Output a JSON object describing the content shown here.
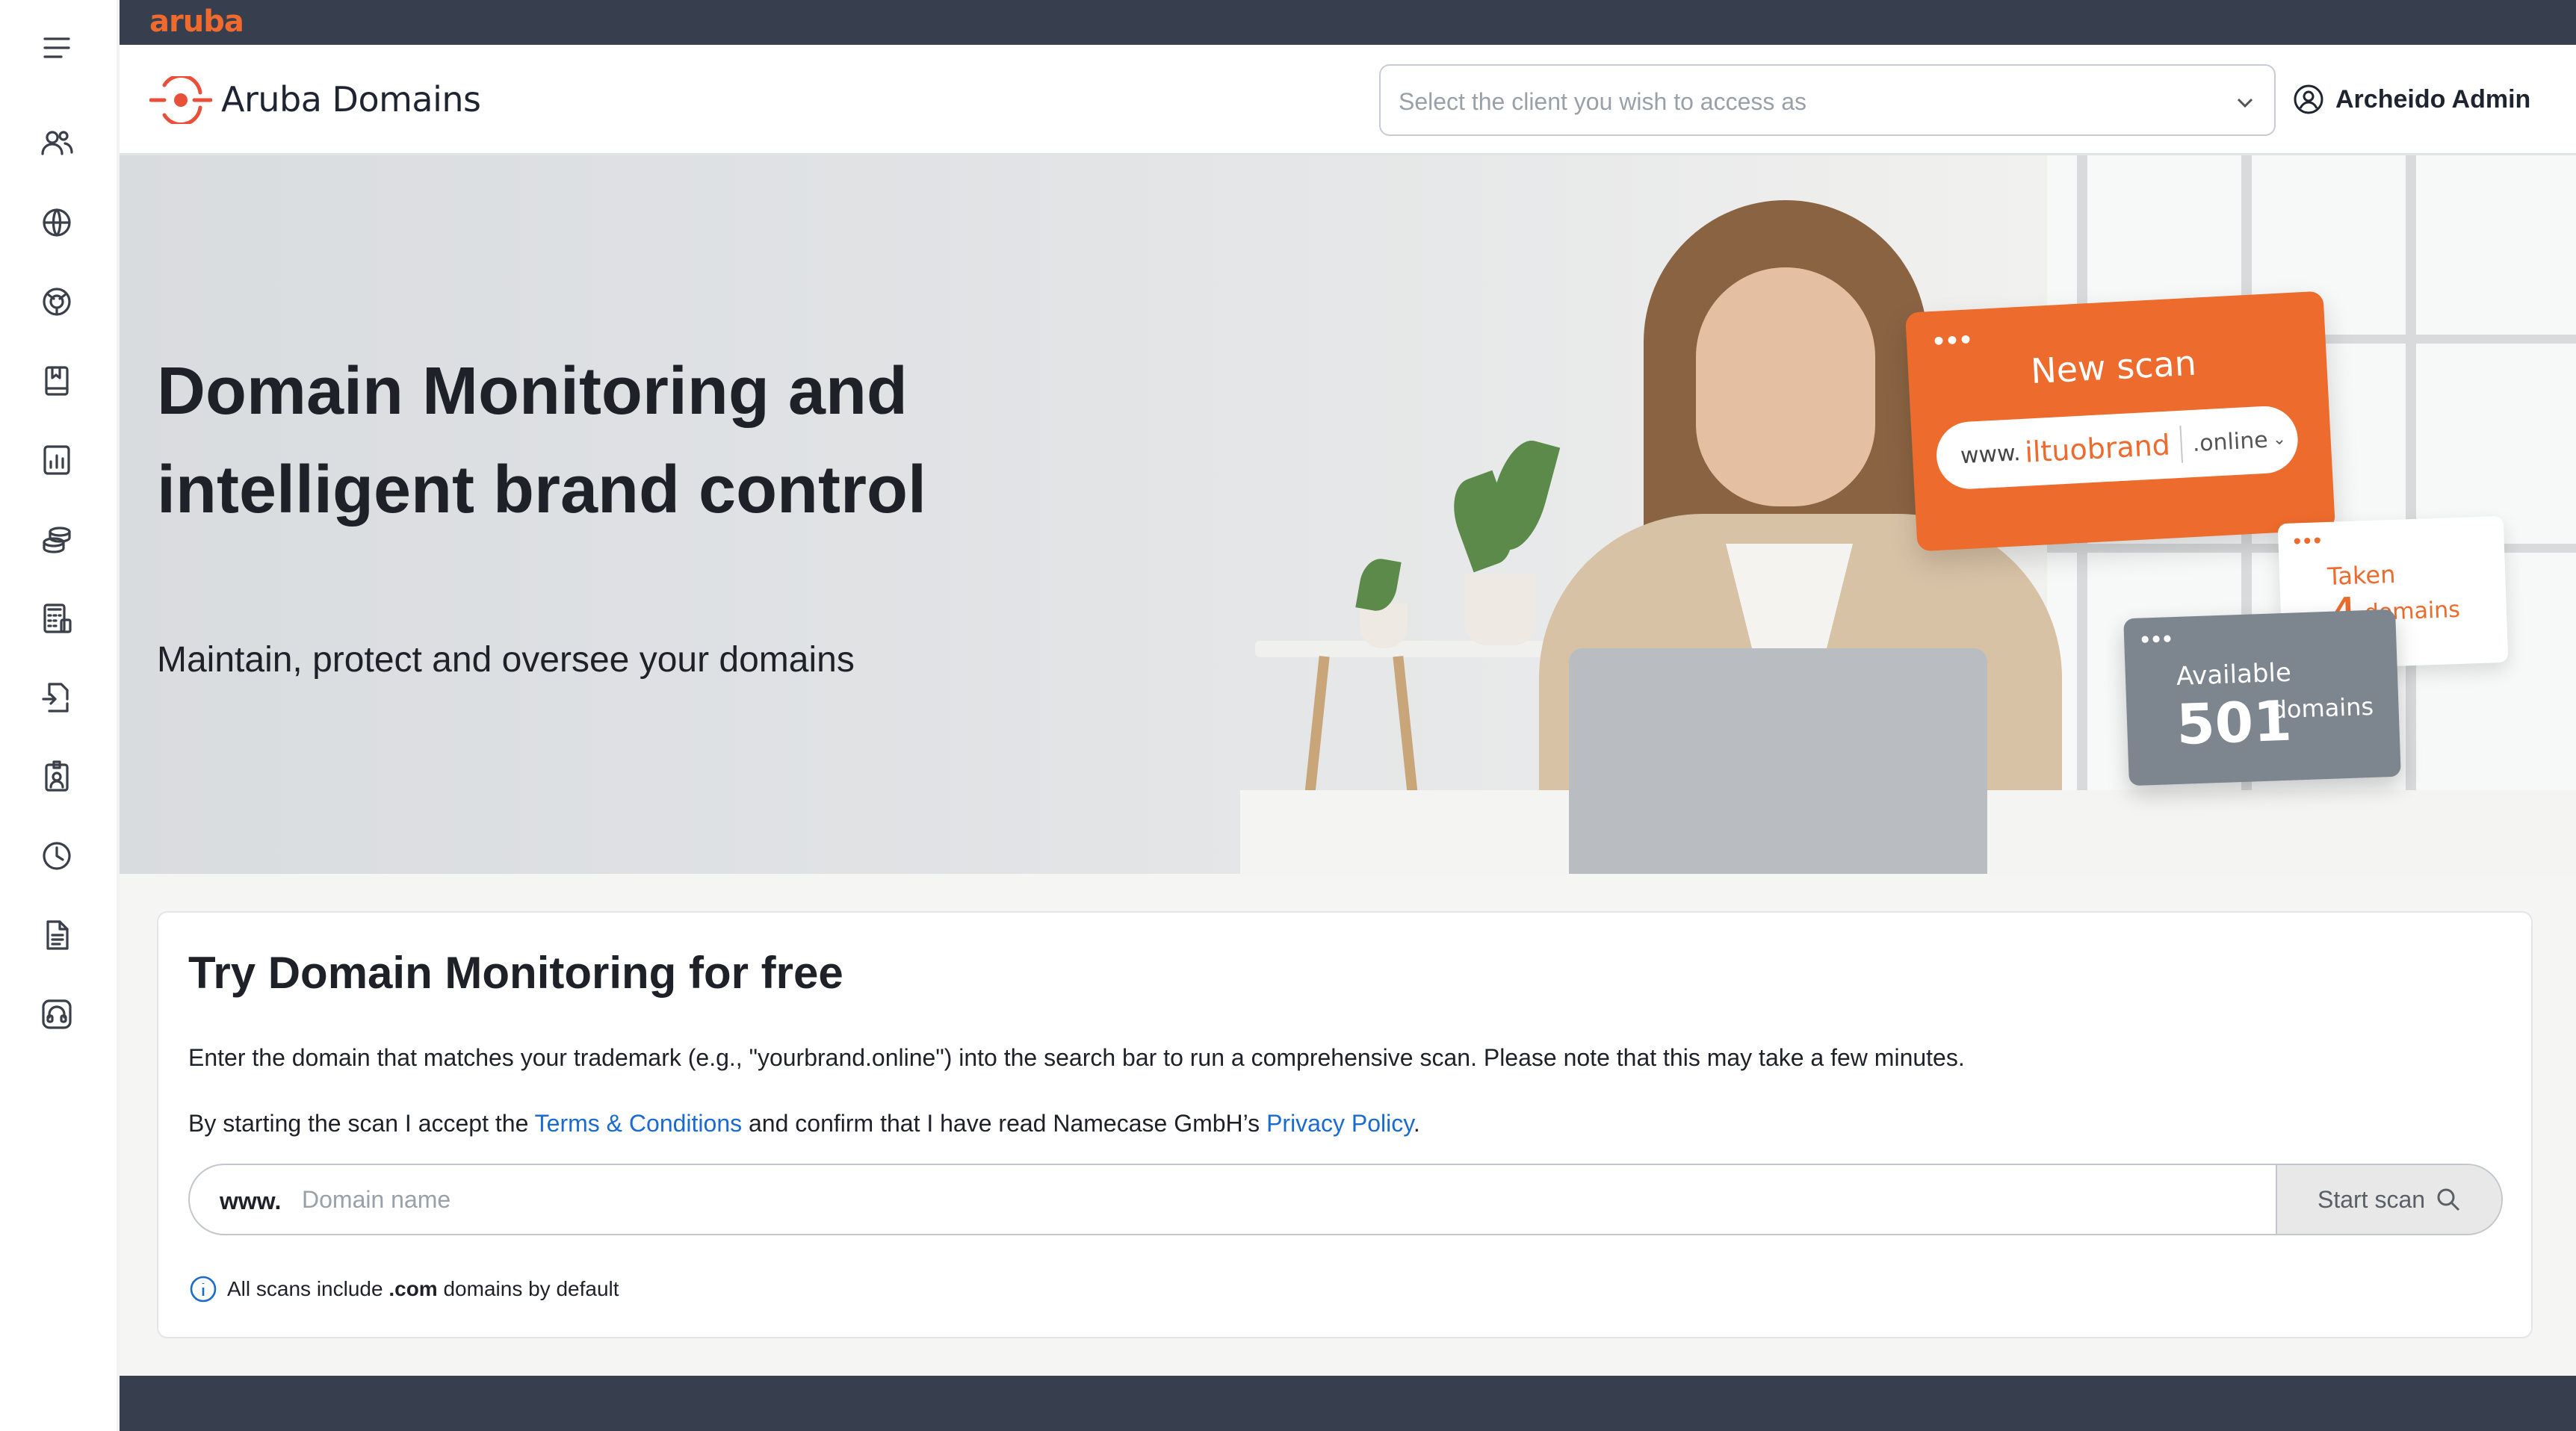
{
  "topbar": {
    "logo_text": "aruba"
  },
  "header": {
    "app_name": "Aruba Domains",
    "client_select_placeholder": "Select the client you wish to access as",
    "user_name": "Archeido Admin"
  },
  "sidebar": {
    "items": [
      {
        "icon": "menu-icon"
      },
      {
        "icon": "users-icon"
      },
      {
        "icon": "globe-icon"
      },
      {
        "icon": "target-globe-icon"
      },
      {
        "icon": "bookmark-book-icon"
      },
      {
        "icon": "analytics-icon"
      },
      {
        "icon": "coins-icon"
      },
      {
        "icon": "calculator-icon"
      },
      {
        "icon": "document-transfer-icon"
      },
      {
        "icon": "id-badge-icon"
      },
      {
        "icon": "clock-icon"
      },
      {
        "icon": "file-text-icon"
      },
      {
        "icon": "headset-icon"
      }
    ]
  },
  "hero": {
    "title": "Domain Monitoring and intelligent brand control",
    "subtitle": "Maintain, protect and oversee your domains",
    "illustration": {
      "new_scan_title": "New scan",
      "url_prefix": "www.",
      "url_brand": "iltuobrand",
      "url_tld": ".online",
      "taken_label": "Taken",
      "taken_count": "4",
      "taken_unit": "domains",
      "available_label": "Available",
      "available_count": "501",
      "available_unit": "domains"
    }
  },
  "trial": {
    "heading": "Try Domain Monitoring for free",
    "description": "Enter the domain that matches your trademark (e.g., \"yourbrand.online\") into the search bar to run a comprehensive scan. Please note that this may take a few minutes.",
    "consent_prefix": "By starting the scan I accept the ",
    "terms_link": "Terms & Conditions",
    "consent_middle": " and confirm that I have read Namecase GmbH’s ",
    "privacy_link": "Privacy Policy",
    "consent_suffix": ".",
    "prefix": "www.",
    "input_placeholder": "Domain name",
    "input_value": "",
    "start_button": "Start scan",
    "note_prefix": "All scans include ",
    "note_bold": ".com",
    "note_suffix": " domains by default"
  },
  "colors": {
    "brand_orange": "#ec6b2d",
    "dark_band": "#373f4f",
    "link_blue": "#1a6bd1"
  }
}
